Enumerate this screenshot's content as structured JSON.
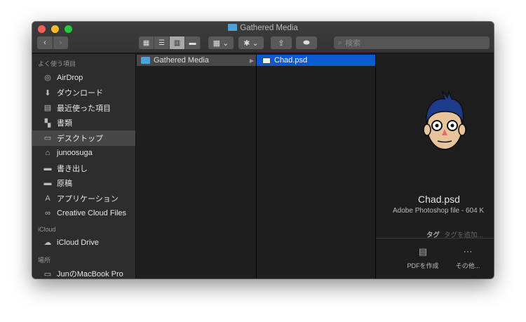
{
  "window": {
    "title": "Gathered Media"
  },
  "toolbar": {
    "back": "‹",
    "forward": "›",
    "search_placeholder": "検索",
    "view_icons": [
      "▦",
      "☰",
      "▥",
      "▬"
    ],
    "group": "▦ ⌄",
    "action": "✱ ⌄",
    "share": "⇪",
    "tag": "⬬"
  },
  "sidebar": {
    "favorites_header": "よく使う項目",
    "favorites": [
      {
        "label": "AirDrop",
        "icon": "◎"
      },
      {
        "label": "ダウンロード",
        "icon": "⬇"
      },
      {
        "label": "最近使った項目",
        "icon": "▤"
      },
      {
        "label": "書類",
        "icon": "▚"
      },
      {
        "label": "デスクトップ",
        "icon": "▭"
      },
      {
        "label": "junoosuga",
        "icon": "⌂"
      },
      {
        "label": "書き出し",
        "icon": "▬"
      },
      {
        "label": "原稿",
        "icon": "▬"
      },
      {
        "label": "アプリケーション",
        "icon": "A"
      },
      {
        "label": "Creative Cloud Files",
        "icon": "∞"
      }
    ],
    "icloud_header": "iCloud",
    "icloud": [
      {
        "label": "iCloud Drive",
        "icon": "☁"
      }
    ],
    "places_header": "場所",
    "places": [
      {
        "label": "JunのMacBook Pro",
        "icon": "▭"
      }
    ]
  },
  "columns": {
    "col1": {
      "item": "Gathered Media"
    },
    "col2": {
      "item": "Chad.psd"
    }
  },
  "preview": {
    "name": "Chad.psd",
    "info": "Adobe Photoshop file - 604 K",
    "tags_label": "タグ",
    "tags_placeholder": "タグを追加...",
    "actions": [
      {
        "label": "PDFを作成",
        "icon": "▤"
      },
      {
        "label": "その他...",
        "icon": "⋯"
      }
    ]
  }
}
